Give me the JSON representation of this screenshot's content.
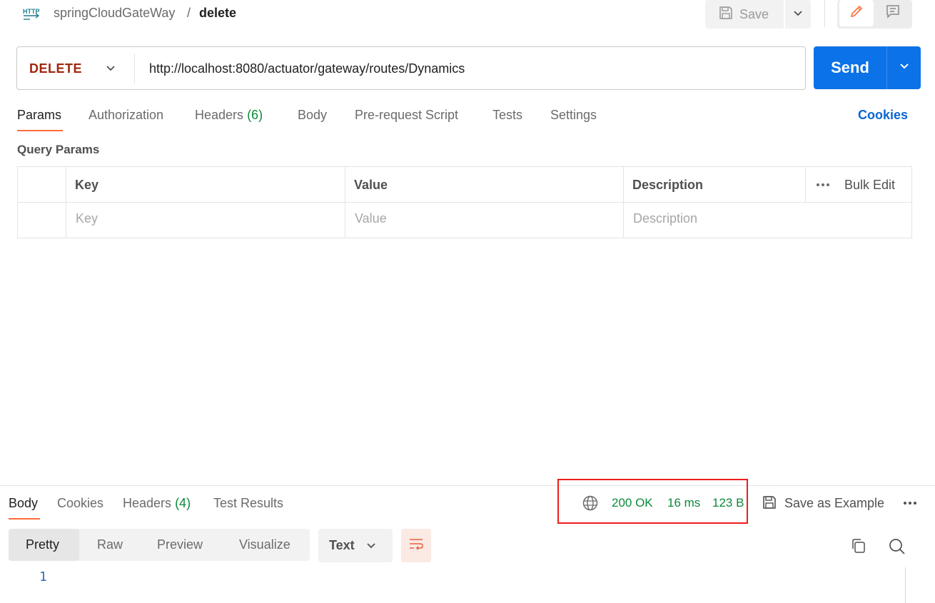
{
  "breadcrumb": {
    "icon": "http-icon",
    "collection": "springCloudGateWay",
    "separator": "/",
    "request": "delete"
  },
  "toolbar": {
    "save_label": "Save"
  },
  "request": {
    "method": "DELETE",
    "url": "http://localhost:8080/actuator/gateway/routes/Dynamics",
    "send_label": "Send"
  },
  "request_tabs": {
    "params": "Params",
    "authorization": "Authorization",
    "headers": "Headers",
    "headers_count": "(6)",
    "body": "Body",
    "prerequest": "Pre-request Script",
    "tests": "Tests",
    "settings": "Settings",
    "cookies": "Cookies"
  },
  "query_params": {
    "title": "Query Params",
    "columns": [
      "Key",
      "Value",
      "Description"
    ],
    "bulk_edit": "Bulk Edit",
    "placeholders": {
      "key": "Key",
      "value": "Value",
      "description": "Description"
    }
  },
  "response": {
    "tabs": {
      "body": "Body",
      "cookies": "Cookies",
      "headers": "Headers",
      "headers_count": "(4)",
      "test_results": "Test Results"
    },
    "status": "200 OK",
    "time": "16 ms",
    "size": "123 B",
    "save_example": "Save as Example",
    "views": [
      "Pretty",
      "Raw",
      "Preview",
      "Visualize"
    ],
    "format": "Text",
    "line_number": "1"
  },
  "colors": {
    "accent": "#ff6c37",
    "send": "#0b72e8",
    "method_delete": "#a1260d",
    "status_ok": "#0b8a3a",
    "highlight": "#ef1c1c"
  }
}
